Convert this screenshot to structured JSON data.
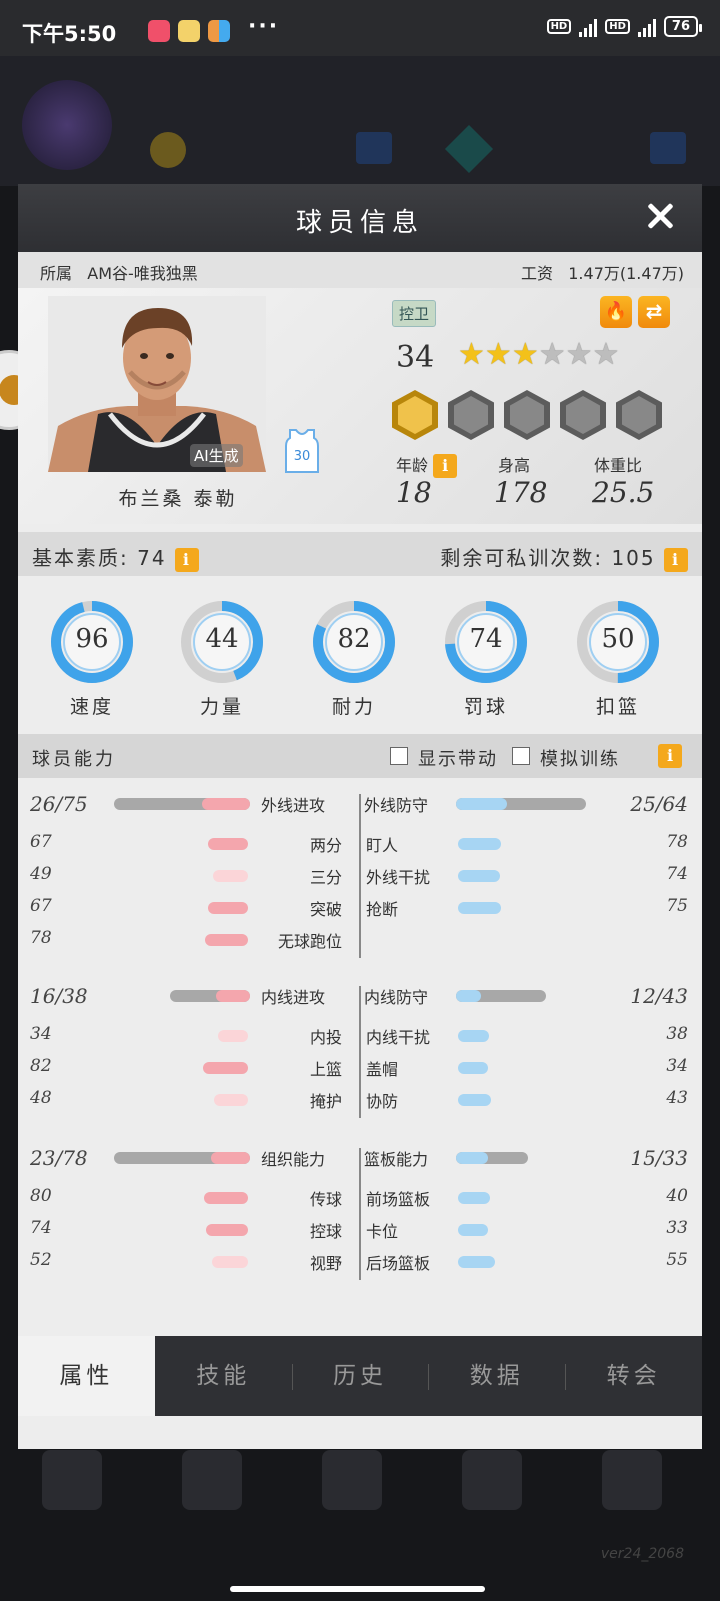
{
  "status_bar": {
    "time": "下午5:50",
    "dots": "···",
    "network1": "HD",
    "network2": "HD",
    "battery": "76"
  },
  "dialog": {
    "title": "球员信息",
    "team_label": "所属",
    "team_name": "AM谷-唯我独黑",
    "salary_label": "工资",
    "salary_value": "1.47万(1.47万)",
    "position": "控卫",
    "ai_badge": "AI生成",
    "jersey_number": "30",
    "player_name": "布兰桑 泰勒",
    "rating": "34",
    "stars_total": 6,
    "stars_filled": 3,
    "badges_total": 5,
    "badges_filled": 1,
    "attributes": [
      {
        "label": "年龄",
        "value": "18"
      },
      {
        "label": "身高",
        "value": "178"
      },
      {
        "label": "体重比",
        "value": "25.5"
      }
    ],
    "basic_quality": "基本素质: 74",
    "remaining_training": "剩余可私训次数: 105",
    "rings": [
      {
        "label": "速度",
        "value": "96",
        "pct": 0.96
      },
      {
        "label": "力量",
        "value": "44",
        "pct": 0.44
      },
      {
        "label": "耐力",
        "value": "82",
        "pct": 0.82
      },
      {
        "label": "罚球",
        "value": "74",
        "pct": 0.74
      },
      {
        "label": "扣篮",
        "value": "50",
        "pct": 0.5
      }
    ],
    "ability_title": "球员能力",
    "show_boost": "显示带动",
    "simulate_training": "模拟训练",
    "info_icon": "i",
    "groups": [
      {
        "left_total": "26/75",
        "left_title": "外线进攻",
        "left_pct": 0.35,
        "right_title": "外线防守",
        "right_total": "25/64",
        "right_pct": 0.39,
        "rows": [
          {
            "lv": "67",
            "ll": "两分",
            "lp": 0.67,
            "rl": "盯人",
            "rv": "78",
            "rp": 0.78
          },
          {
            "lv": "49",
            "ll": "三分",
            "lp": 0.49,
            "rl": "外线干扰",
            "rv": "74",
            "rp": 0.74
          },
          {
            "lv": "67",
            "ll": "突破",
            "lp": 0.67,
            "rl": "抢断",
            "rv": "75",
            "rp": 0.75
          },
          {
            "lv": "78",
            "ll": "无球跑位",
            "lp": 0.78,
            "rl": "",
            "rv": "",
            "rp": 0
          }
        ]
      },
      {
        "left_total": "16/38",
        "left_title": "内线进攻",
        "left_pct": 0.42,
        "right_title": "内线防守",
        "right_total": "12/43",
        "right_pct": 0.28,
        "rows": [
          {
            "lv": "34",
            "ll": "内投",
            "lp": 0.34,
            "rl": "内线干扰",
            "rv": "38",
            "rp": 0.38
          },
          {
            "lv": "82",
            "ll": "上篮",
            "lp": 0.82,
            "rl": "盖帽",
            "rv": "34",
            "rp": 0.34
          },
          {
            "lv": "48",
            "ll": "掩护",
            "lp": 0.48,
            "rl": "协防",
            "rv": "43",
            "rp": 0.43
          }
        ]
      },
      {
        "left_total": "23/78",
        "left_title": "组织能力",
        "left_pct": 0.29,
        "right_title": "篮板能力",
        "right_total": "15/33",
        "right_pct": 0.45,
        "rows": [
          {
            "lv": "80",
            "ll": "传球",
            "lp": 0.8,
            "rl": "前场篮板",
            "rv": "40",
            "rp": 0.4
          },
          {
            "lv": "74",
            "ll": "控球",
            "lp": 0.74,
            "rl": "卡位",
            "rv": "33",
            "rp": 0.33
          },
          {
            "lv": "52",
            "ll": "视野",
            "lp": 0.52,
            "rl": "后场篮板",
            "rv": "55",
            "rp": 0.55
          }
        ]
      }
    ],
    "tabs": [
      "属性",
      "技能",
      "历史",
      "数据",
      "转会"
    ],
    "active_tab": 0
  },
  "version": "ver24_2068",
  "colors": {
    "accent_orange": "#f4a81c",
    "ring_blue": "#3fa3ea",
    "attack_pink": "#f4a6ad",
    "defense_blue": "#a7d5f3"
  }
}
